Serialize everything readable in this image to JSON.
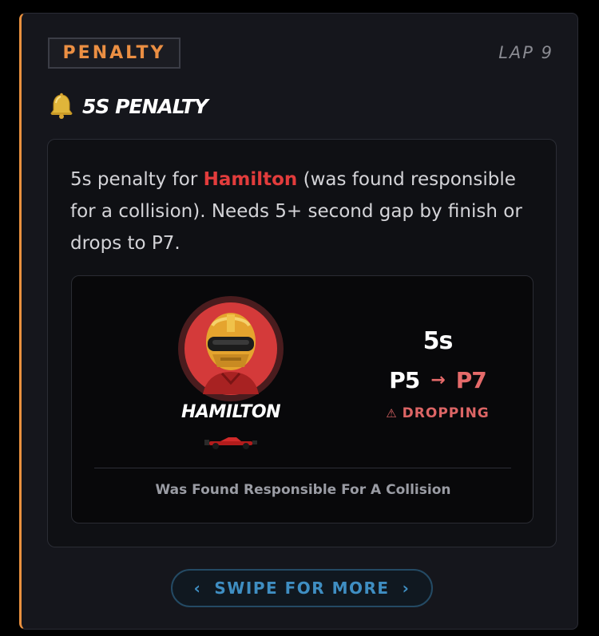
{
  "card": {
    "tag": "PENALTY",
    "lap": "LAP 9",
    "title": "5S PENALTY",
    "icon": "bell-icon",
    "accent_color": "#e9903f"
  },
  "description": {
    "before": "5s penalty for ",
    "highlight": "Hamilton",
    "after": " (was found responsible for a collision). Needs 5+ second gap by finish or drops to P7.",
    "highlight_color": "#e23c3c"
  },
  "driver": {
    "name": "HAMILTON",
    "avatar": "driver-helmet-avatar",
    "car": "race-car-icon"
  },
  "penalty": {
    "value": "5s",
    "from_position": "P5",
    "arrow": "→",
    "to_position": "P7",
    "status_icon": "⚠",
    "status": "DROPPING",
    "status_color": "#dc6565"
  },
  "reason": "Was Found Responsible For A Collision",
  "swipe": {
    "left_chevron": "‹",
    "label": "SWIPE FOR MORE",
    "right_chevron": "›",
    "color": "#3f8ec2"
  }
}
